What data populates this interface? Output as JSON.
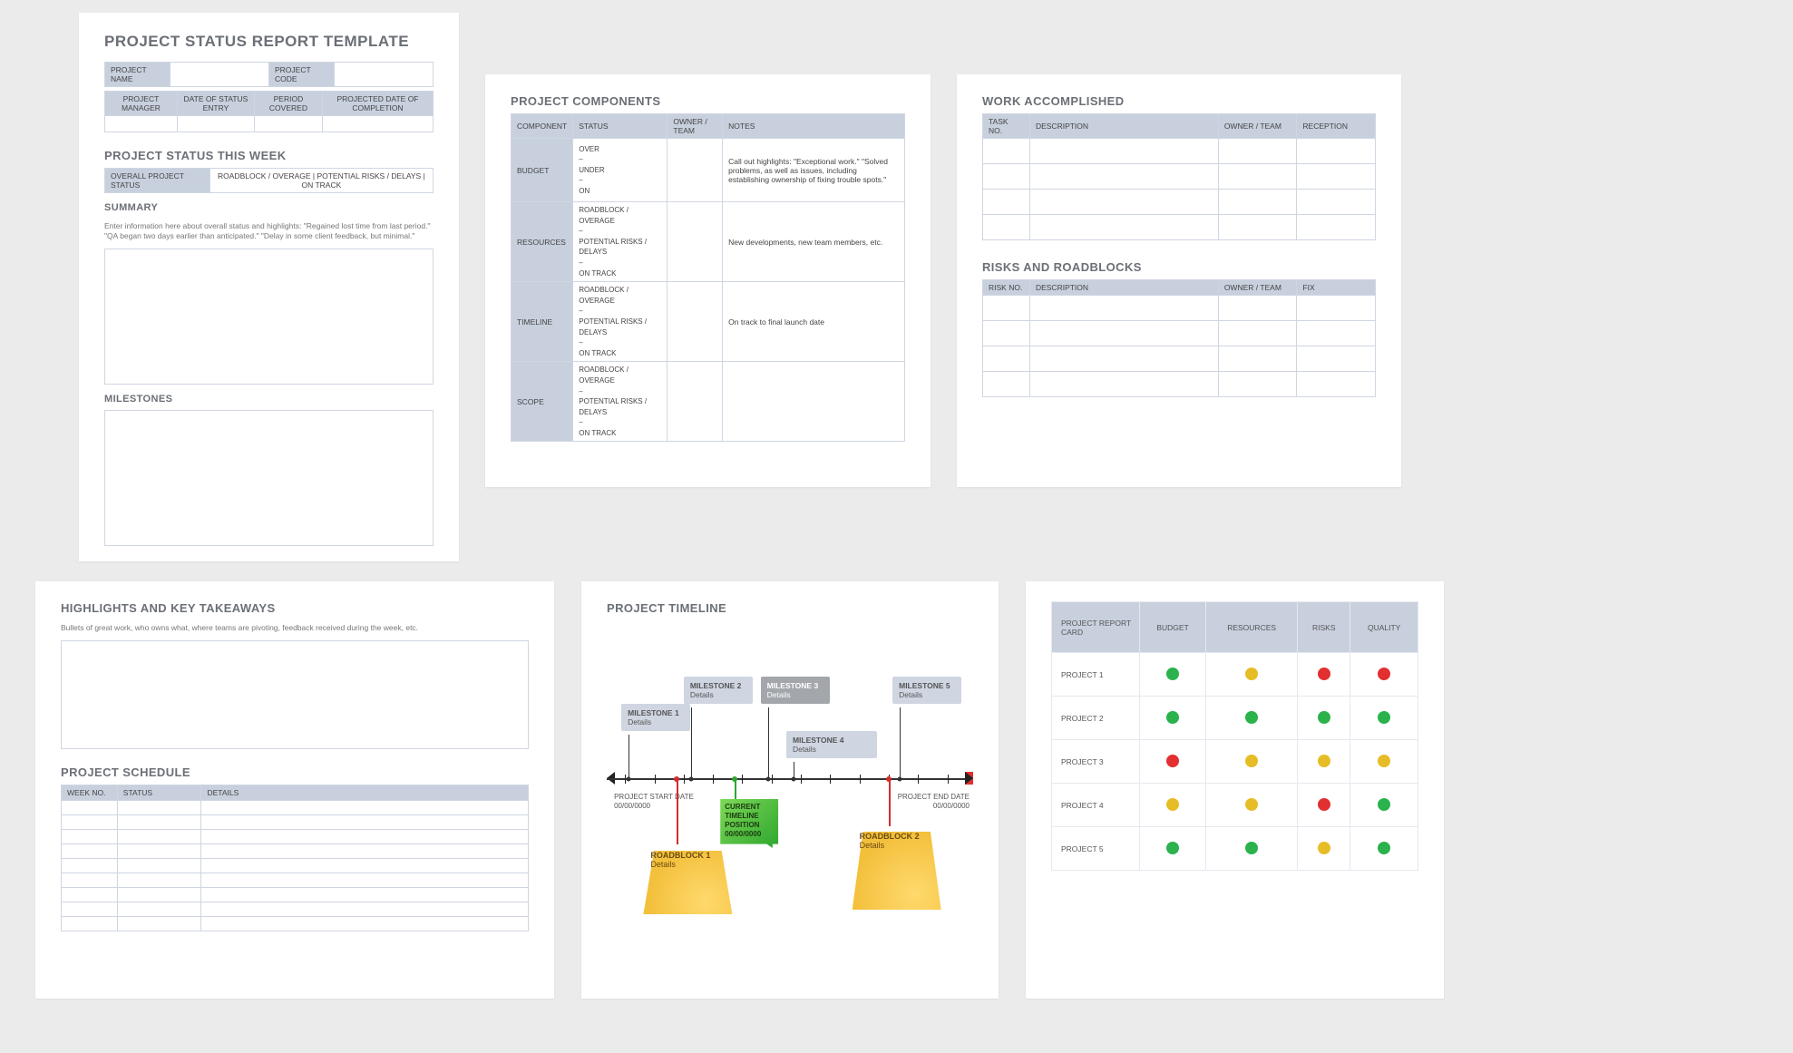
{
  "card1": {
    "title": "PROJECT STATUS REPORT TEMPLATE",
    "meta1": {
      "name_label": "PROJECT NAME",
      "code_label": "PROJECT CODE"
    },
    "meta2_headers": [
      "PROJECT MANAGER",
      "DATE OF STATUS ENTRY",
      "PERIOD COVERED",
      "PROJECTED DATE OF COMPLETION"
    ],
    "status_week_title": "PROJECT STATUS THIS WEEK",
    "status_label": "OVERALL PROJECT STATUS",
    "status_options": "ROADBLOCK / OVERAGE   |   POTENTIAL RISKS / DELAYS   |   ON TRACK",
    "summary_title": "SUMMARY",
    "summary_help": "Enter information here about overall status and highlights: \"Regained lost time from last period.\" \"QA began two days earlier than anticipated.\" \"Delay in some client feedback, but minimal.\"",
    "milestones_title": "MILESTONES"
  },
  "card2": {
    "title": "PROJECT COMPONENTS",
    "headers": [
      "COMPONENT",
      "STATUS",
      "OWNER / TEAM",
      "NOTES"
    ],
    "rows": [
      {
        "name": "BUDGET",
        "status": "OVER\n–\nUNDER\n–\nON",
        "notes": "Call out highlights: \"Exceptional work.\" \"Solved problems, as well as issues, including establishing ownership of fixing trouble spots.\""
      },
      {
        "name": "RESOURCES",
        "status": "ROADBLOCK / OVERAGE\n–\nPOTENTIAL RISKS / DELAYS\n–\nON TRACK",
        "notes": "New developments, new team members, etc."
      },
      {
        "name": "TIMELINE",
        "status": "ROADBLOCK / OVERAGE\n–\nPOTENTIAL RISKS / DELAYS\n–\nON TRACK",
        "notes": "On track to final launch date"
      },
      {
        "name": "SCOPE",
        "status": "ROADBLOCK / OVERAGE\n–\nPOTENTIAL RISKS / DELAYS\n–\nON TRACK",
        "notes": ""
      }
    ]
  },
  "card3": {
    "work_title": "WORK ACCOMPLISHED",
    "work_headers": [
      "TASK NO.",
      "DESCRIPTION",
      "OWNER / TEAM",
      "RECEPTION"
    ],
    "risk_title": "RISKS AND ROADBLOCKS",
    "risk_headers": [
      "RISK NO.",
      "DESCRIPTION",
      "OWNER / TEAM",
      "FIX"
    ]
  },
  "card4": {
    "hi_title": "HIGHLIGHTS AND KEY TAKEAWAYS",
    "hi_help": "Bullets of great work, who owns what, where teams are pivoting, feedback received during the week, etc.",
    "sched_title": "PROJECT SCHEDULE",
    "sched_headers": [
      "WEEK NO.",
      "STATUS",
      "DETAILS"
    ]
  },
  "card5": {
    "title": "PROJECT TIMELINE",
    "start_label": "PROJECT START DATE",
    "start_date": "00/00/0000",
    "end_label": "PROJECT END DATE",
    "end_date": "00/00/0000",
    "current_label": "CURRENT TIMELINE POSITION",
    "current_date": "00/00/0000",
    "details": "Details",
    "milestones": [
      "MILESTONE 1",
      "MILESTONE 2",
      "MILESTONE 3",
      "MILESTONE 4",
      "MILESTONE 5"
    ],
    "roadblocks": [
      "ROADBLOCK 1",
      "ROADBLOCK 2"
    ]
  },
  "card6": {
    "header_first": "PROJECT REPORT CARD",
    "headers": [
      "BUDGET",
      "RESOURCES",
      "RISKS",
      "QUALITY"
    ],
    "rows": [
      {
        "name": "PROJECT 1",
        "vals": [
          "g",
          "y",
          "r",
          "r"
        ]
      },
      {
        "name": "PROJECT 2",
        "vals": [
          "g",
          "g",
          "g",
          "g"
        ]
      },
      {
        "name": "PROJECT 3",
        "vals": [
          "r",
          "y",
          "y",
          "y"
        ]
      },
      {
        "name": "PROJECT 4",
        "vals": [
          "y",
          "y",
          "r",
          "g"
        ]
      },
      {
        "name": "PROJECT 5",
        "vals": [
          "g",
          "g",
          "y",
          "g"
        ]
      }
    ]
  }
}
